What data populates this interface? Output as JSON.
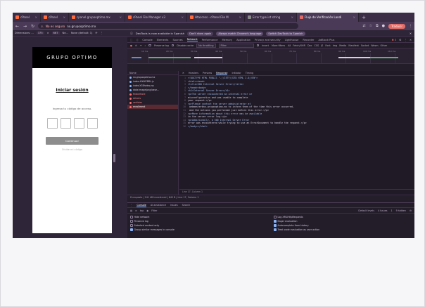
{
  "browser": {
    "tabs": [
      {
        "label": "cPanel",
        "color": "#ff6b3d"
      },
      {
        "label": "cPanel",
        "color": "#ff6b3d"
      },
      {
        "label": "cpanel.grupooptimo.mx",
        "color": "#ff6b3d"
      },
      {
        "label": "cPanel File Manager v3",
        "color": "#ff6b3d"
      },
      {
        "label": "Htaccess - cPanel File M",
        "color": "#ff6b3d"
      },
      {
        "label": "Error type int string",
        "color": "#888888"
      },
      {
        "label": "Flujo de Verificación Landi",
        "color": "#e46b65"
      }
    ],
    "new_tab": "+",
    "security_label": "No es seguro",
    "url": "nx.grupooptimo.mx",
    "translate_badge": "Traducir"
  },
  "device_toolbar": {
    "dimensions": "Dimensions: ...",
    "width": "375",
    "height": "667",
    "zoom": "Ne...",
    "throttle": "None (default: 1)"
  },
  "login_page": {
    "brand": "GRUPO OPTIMO",
    "title": "Iniciar sesión",
    "subtitle": "Ingresa tu código de acceso.",
    "code_boxes": 4,
    "continue_label": "Continuar",
    "resend_label": "Olvide mi código"
  },
  "devtools": {
    "banner": {
      "message": "DevTools is now available in Spanish",
      "dont_show": "Don't show again",
      "match_language": "Always match Chrome's language",
      "switch_language": "Switch DevTools to Spanish"
    },
    "tabs": [
      "Console",
      "Elements",
      "Sources",
      "Network",
      "Performance",
      "Memory",
      "Application",
      "Privacy and security",
      "Lighthouse",
      "Recorder",
      "AdBlock Plus"
    ],
    "active_tab": "Network",
    "error_count": "3",
    "filters": {
      "preserve_log": "Preserve log",
      "disable_cache": "Disable cache",
      "throttle": "No throttling",
      "filter_placeholder": "Filter",
      "invert": "Invert",
      "more_filters": "More filters",
      "types": [
        "All",
        "Fetch/XHR",
        "Doc",
        "CSS",
        "JS",
        "Font",
        "Img",
        "Media",
        "Manifest",
        "Socket",
        "Wasm",
        "Other"
      ]
    },
    "timeline_ticks": [
      "10 ms",
      "20 ms",
      "30 ms",
      "40 ms",
      "50 ms",
      "60 ms",
      "70 ms",
      "80 ms",
      "90 ms",
      "100 ms",
      "110 ms"
    ],
    "requests_header": "Name",
    "requests": [
      {
        "name": "nx.grupooptimo.mx",
        "status": "ok"
      },
      {
        "name": "index-HXWCBRL.js",
        "status": "ok"
      },
      {
        "name": "index-Y1Bhekw.css",
        "status": "ok"
      },
      {
        "name": "data:image/png;base...",
        "status": "ok"
      },
      {
        "name": "findvehicle",
        "status": "error"
      },
      {
        "name": "drivers",
        "status": "error"
      },
      {
        "name": "vehicles",
        "status": "error"
      },
      {
        "name": "enrollment",
        "status": "selected"
      }
    ],
    "detail_tabs": [
      "Headers",
      "Preview",
      "Response",
      "Initiator",
      "Timing"
    ],
    "active_detail_tab": "Response",
    "response_lines": [
      "<!DOCTYPE HTML PUBLIC \"-//IETF//DTD HTML 2.0//EN\">",
      "<html><head>",
      "<title>500 Internal Server Error</title>",
      "</head><body>",
      "<h1>Internal Server Error</h1>",
      "<p>The server encountered an internal error or",
      "misconfiguration and was unable to complete",
      "your request.</p>",
      "<p>Please contact the server administrator at",
      " webmaster@nx.grupooptimo.mx to inform them of the time this error occurred,",
      " and the actions you performed just before this error.</p>",
      "<p>More information about this error may be available",
      "in the server error log.</p>",
      "<p>Additionally, a 500 Internal Server Error",
      "error was encountered while trying to use an ErrorDocument to handle the request.</p>",
      "</body></html>"
    ],
    "detail_status": "Line 17, Column 1",
    "summary": "8 requests  |  241 kB transferred  |  645 B  |  Line 17, Column 1",
    "drawer": {
      "tabs": [
        "Console",
        "AI assistance",
        "Issues",
        "Search"
      ],
      "active": "Console",
      "context": "top",
      "filter_placeholder": "Filter",
      "levels": "Default levels",
      "issues": "4 Issues",
      "issue_count": "1",
      "hidden": "9 hidden",
      "options": [
        {
          "label": "Hide network",
          "checked": false
        },
        {
          "label": "Log XMLHttpRequests",
          "checked": false
        },
        {
          "label": "Preserve log",
          "checked": false
        },
        {
          "label": "Eager evaluation",
          "checked": true
        },
        {
          "label": "Selected context only",
          "checked": false
        },
        {
          "label": "Autocomplete from history",
          "checked": true
        },
        {
          "label": "Group similar messages in console",
          "checked": true
        },
        {
          "label": "Treat code evaluation as user action",
          "checked": true
        }
      ]
    }
  }
}
